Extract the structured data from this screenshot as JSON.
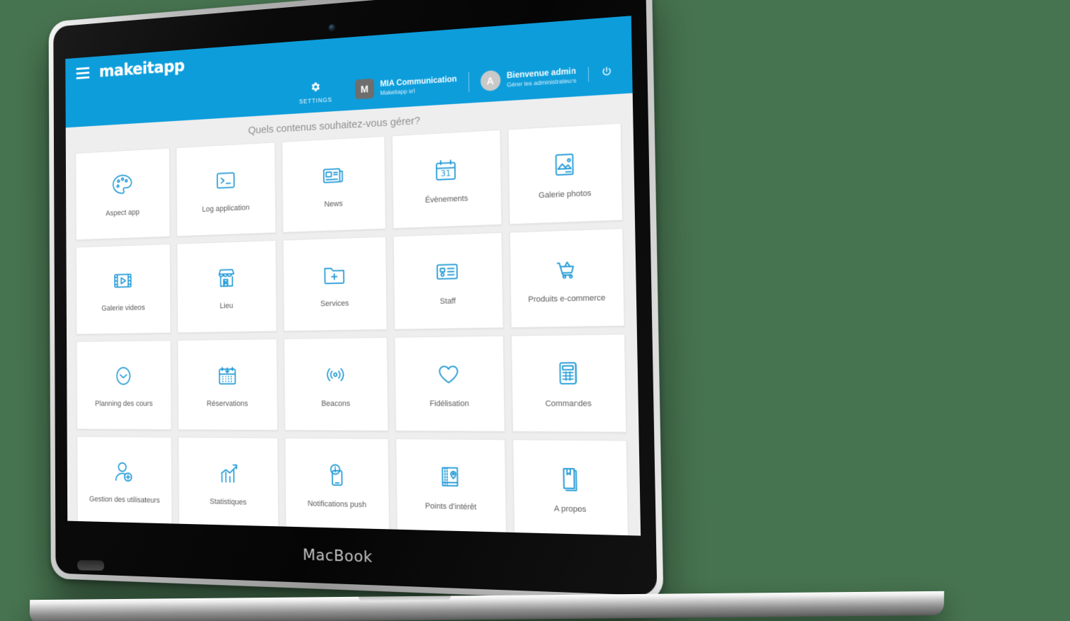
{
  "device": {
    "brand_label": "MacBook"
  },
  "topbar": {
    "menu_icon": "hamburger-icon",
    "logo_text": "makeitapp",
    "settings": {
      "icon": "gear-icon",
      "label": "SETTINGS"
    },
    "company": {
      "avatar_initial": "M",
      "name": "MIA Communication",
      "subtitle": "Makeitapp srl"
    },
    "user": {
      "avatar_initial": "A",
      "name": "Bienvenue admin",
      "subtitle": "Gérer les administrateurs"
    },
    "logout": {
      "icon": "power-icon"
    }
  },
  "main": {
    "title": "Quels contenus souhaitez-vous gérer?",
    "tiles": [
      {
        "label": "Aspect app",
        "icon": "palette-icon"
      },
      {
        "label": "Log application",
        "icon": "terminal-icon"
      },
      {
        "label": "News",
        "icon": "newspaper-icon"
      },
      {
        "label": "Évènements",
        "icon": "calendar-31-icon"
      },
      {
        "label": "Galerie photos",
        "icon": "photo-icon"
      },
      {
        "label": "Galerie videos",
        "icon": "film-play-icon"
      },
      {
        "label": "Lieu",
        "icon": "storefront-icon"
      },
      {
        "label": "Services",
        "icon": "folder-plus-icon"
      },
      {
        "label": "Staff",
        "icon": "id-card-icon"
      },
      {
        "label": "Produits e-commerce",
        "icon": "shopping-cart-icon"
      },
      {
        "label": "Planning des cours",
        "icon": "clock-icon"
      },
      {
        "label": "Réservations",
        "icon": "calendar-booking-icon"
      },
      {
        "label": "Beacons",
        "icon": "signal-waves-icon"
      },
      {
        "label": "Fidélisation",
        "icon": "heart-icon"
      },
      {
        "label": "Commandes",
        "icon": "calculator-icon"
      },
      {
        "label": "Gestion des utilisateurs",
        "icon": "user-plus-icon"
      },
      {
        "label": "Statistiques",
        "icon": "bar-chart-arrow-icon"
      },
      {
        "label": "Notifications push",
        "icon": "phone-info-icon"
      },
      {
        "label": "Points d'intérêt",
        "icon": "book-map-pin-icon"
      },
      {
        "label": "A propos",
        "icon": "book-bookmark-icon"
      }
    ]
  },
  "colors": {
    "brand_blue": "#0d9ddb",
    "icon_blue": "#1b97d5",
    "page_background": "#eeeeee",
    "tile_background": "#ffffff",
    "canvas_background": "#477450"
  }
}
